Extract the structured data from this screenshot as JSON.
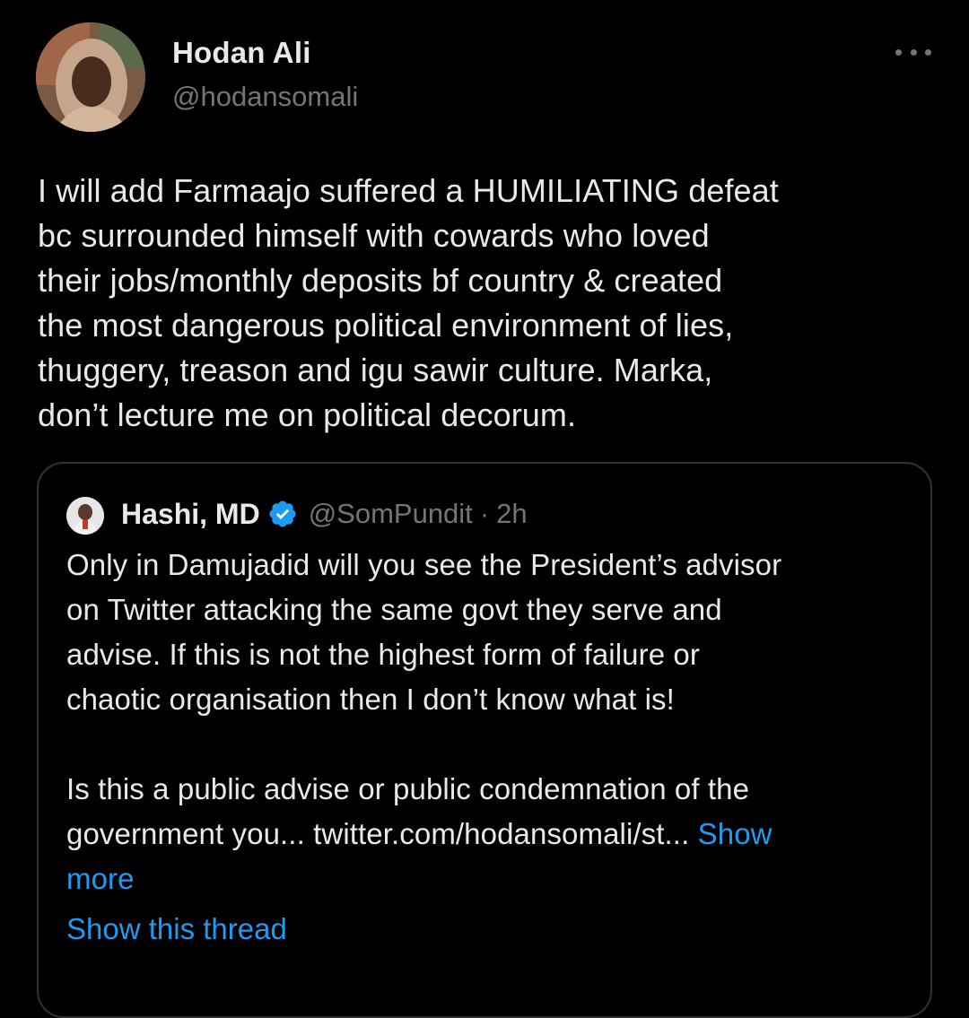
{
  "tweet": {
    "display_name": "Hodan Ali",
    "handle": "@hodansomali",
    "text": "I will add Farmaajo suffered a HUMILIATING defeat\nbc surrounded himself with cowards who loved\ntheir jobs/monthly deposits bf country & created\nthe most dangerous political environment of lies,\nthuggery, treason and igu sawir culture. Marka,\ndon’t lecture me on political decorum.",
    "more_icon": "more-horizontal-icon"
  },
  "quoted_tweet": {
    "display_name": "Hashi, MD",
    "verified_icon": "verified-badge-icon",
    "handle": "@SomPundit",
    "separator": "·",
    "time": "2h",
    "paragraph_1": "Only in Damujadid will you see the President’s advisor\non Twitter attacking the same govt they serve and\nadvise. If this is not the highest form of failure or\nchaotic organisation then I don’t know what is!",
    "paragraph_2": "Is this a public advise or public condemnation of the\ngovernment you... twitter.com/hodansomali/st...",
    "show_more": "Show\nmore",
    "show_thread": "Show this thread"
  },
  "colors": {
    "background": "#000000",
    "text_primary": "#e7e9ea",
    "text_secondary": "#71767b",
    "link": "#1d9bf0",
    "border": "#2f3336",
    "verified": "#1d9bf0"
  }
}
